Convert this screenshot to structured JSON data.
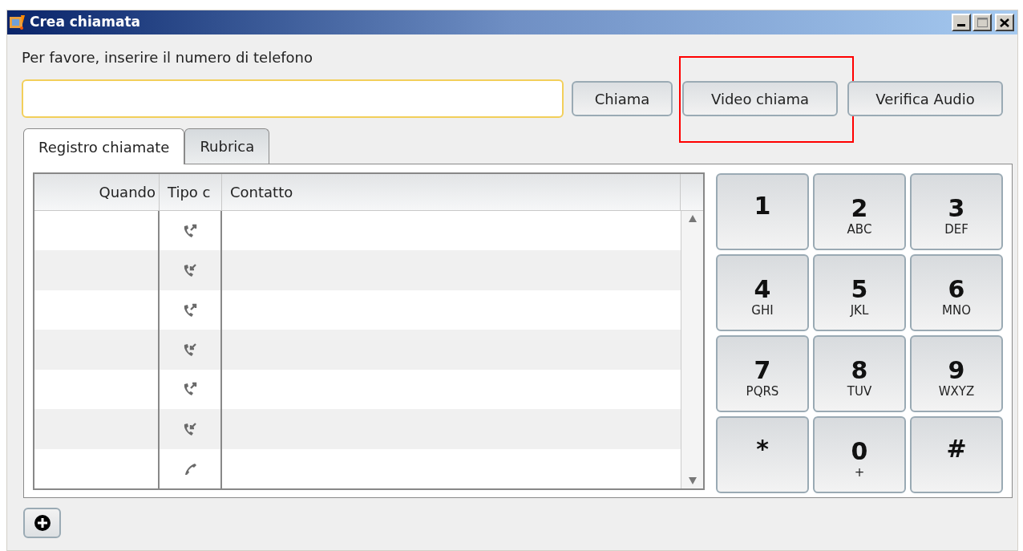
{
  "window": {
    "title": "Crea chiamata"
  },
  "prompt": "Per favore, inserire il numero di telefono",
  "buttons": [
    {
      "label": "Chiama",
      "highlighted": false
    },
    {
      "label": "Video chiama",
      "highlighted": true
    },
    {
      "label": "Verifica Audio",
      "highlighted": false
    }
  ],
  "tabs": [
    {
      "label": "Registro chiamate",
      "selected": true
    },
    {
      "label": "Rubrica",
      "selected": false
    }
  ],
  "table": {
    "columns": [
      "Quando",
      "Tipo c",
      "Contatto"
    ],
    "rows": [
      {
        "kind": "outgoing"
      },
      {
        "kind": "incoming"
      },
      {
        "kind": "outgoing"
      },
      {
        "kind": "incoming"
      },
      {
        "kind": "outgoing"
      },
      {
        "kind": "incoming"
      },
      {
        "kind": "call"
      }
    ]
  },
  "keypad": [
    {
      "digit": "1"
    },
    {
      "digit": "2",
      "letters": "ABC"
    },
    {
      "digit": "3",
      "letters": "DEF"
    },
    {
      "digit": "4",
      "letters": "GHI"
    },
    {
      "digit": "5",
      "letters": "JKL"
    },
    {
      "digit": "6",
      "letters": "MNO"
    },
    {
      "digit": "7",
      "letters": "PQRS"
    },
    {
      "digit": "8",
      "letters": "TUV"
    },
    {
      "digit": "9",
      "letters": "WXYZ"
    },
    {
      "digit": "*"
    },
    {
      "digit": "0",
      "letters": "+"
    },
    {
      "digit": "#"
    }
  ]
}
